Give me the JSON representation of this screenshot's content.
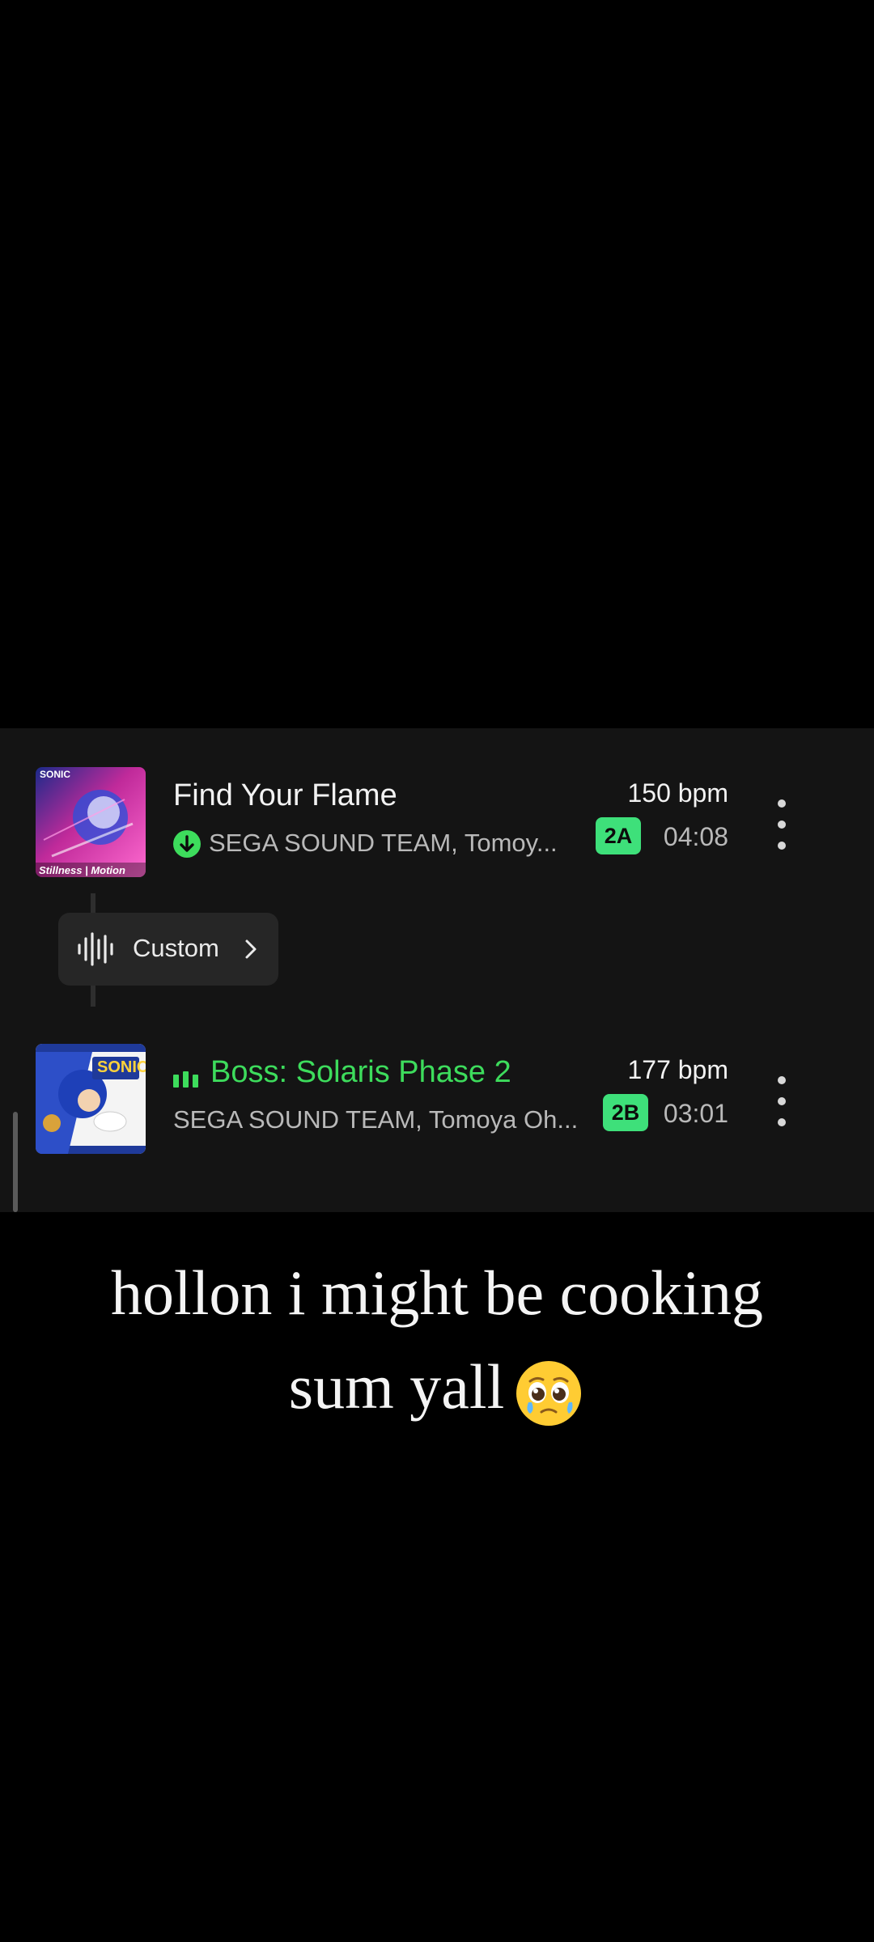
{
  "tracks": [
    {
      "title": "Find Your Flame",
      "artist": "SEGA SOUND TEAM, Tomoy...",
      "bpm": "150 bpm",
      "key": "2A",
      "duration": "04:08",
      "status_icon": "download-complete-icon",
      "art_text_top": "SONIC",
      "art_text_bottom": "Stillness | Motion"
    },
    {
      "title": "Boss: Solaris Phase 2",
      "artist": "SEGA SOUND TEAM, Tomoya Oh...",
      "bpm": "177 bpm",
      "key": "2B",
      "duration": "03:01",
      "status_icon": "now-playing-equalizer-icon",
      "art_text_top": "SONIC"
    }
  ],
  "transition": {
    "label": "Custom",
    "icon": "waveform-icon"
  },
  "caption": {
    "line1": "hollon i might be cooking",
    "line2": "sum yall",
    "emoji": "pleading-face-with-tears-emoji"
  },
  "colors": {
    "accent_green": "#3ddc5c",
    "key_badge": "#3ee07a",
    "panel": "#141414",
    "background": "#000000"
  }
}
